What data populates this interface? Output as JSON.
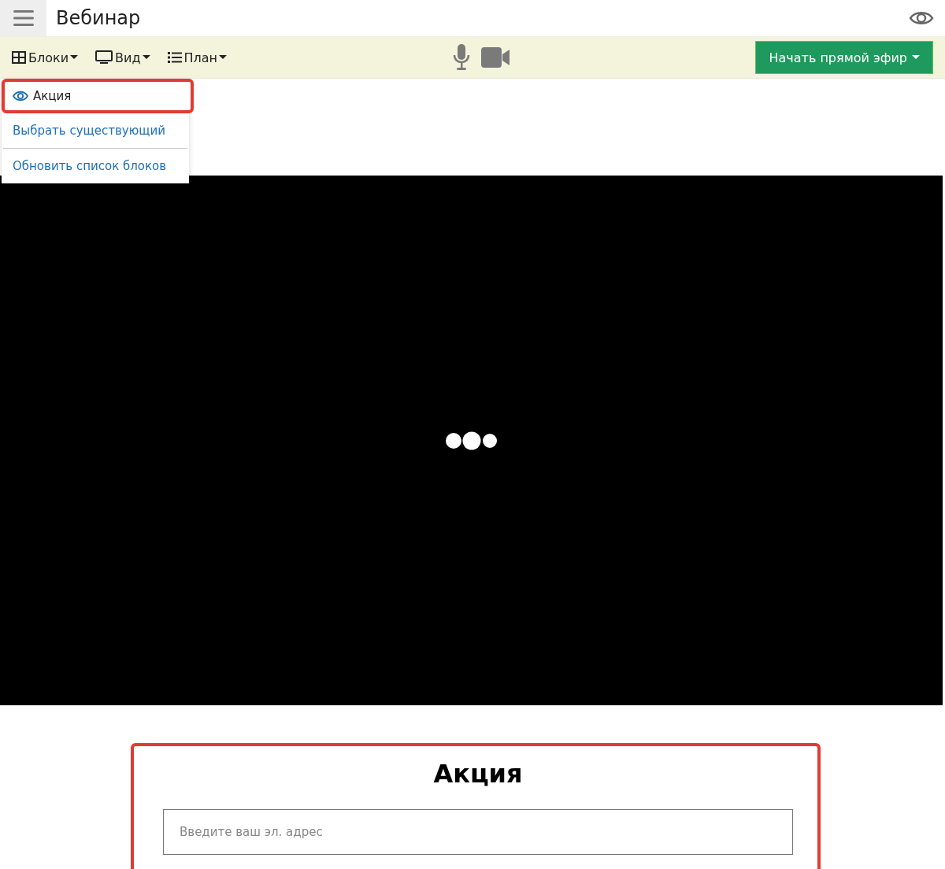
{
  "header": {
    "title": "Вебинар"
  },
  "toolbar": {
    "menus": [
      {
        "label": "Блоки",
        "kind": "blocks"
      },
      {
        "label": "Вид",
        "kind": "view"
      },
      {
        "label": "План",
        "kind": "plan"
      }
    ],
    "live_button": "Начать прямой эфир"
  },
  "dropdown": {
    "items": [
      {
        "label": "Акция",
        "kind": "block",
        "highlighted": true
      },
      {
        "label": "Выбрать существующий",
        "kind": "action",
        "highlighted": false
      },
      {
        "label": "Обновить список блоков",
        "kind": "action",
        "highlighted": false
      }
    ]
  },
  "promo": {
    "title": "Акция",
    "placeholder": "Введите ваш эл. адрес",
    "highlighted": true
  }
}
